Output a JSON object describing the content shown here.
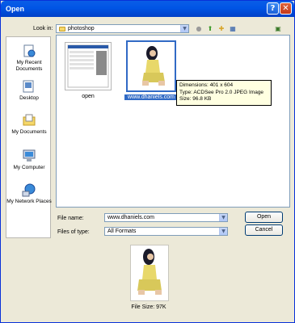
{
  "window": {
    "title": "Open"
  },
  "titlebar_buttons": {
    "help": "?",
    "close": "✕"
  },
  "look_in": {
    "label": "Look in:",
    "value": "photoshop"
  },
  "places": [
    {
      "label": "My Recent Documents"
    },
    {
      "label": "Desktop"
    },
    {
      "label": "My Documents"
    },
    {
      "label": "My Computer"
    },
    {
      "label": "My Network Places"
    }
  ],
  "files": [
    {
      "name": "open"
    },
    {
      "name": "www.dhaniels.com"
    }
  ],
  "tooltip": {
    "line1": "Dimensions: 401 x 604",
    "line2": "Type: ACDSee Pro 2.0 JPEG Image",
    "line3": "Size: 96.8 KB"
  },
  "file_name": {
    "label": "File name:",
    "value": "www.dhaniels.com"
  },
  "files_of_type": {
    "label": "Files of type:",
    "value": "All Formats"
  },
  "buttons": {
    "open": "Open",
    "cancel": "Cancel"
  },
  "preview": {
    "file_size": "File Size: 97K"
  },
  "colors": {
    "titlebar": "#0055e5",
    "dialog_bg": "#ece9d8",
    "selection": "#316ac5",
    "tooltip_bg": "#ffffe1"
  }
}
